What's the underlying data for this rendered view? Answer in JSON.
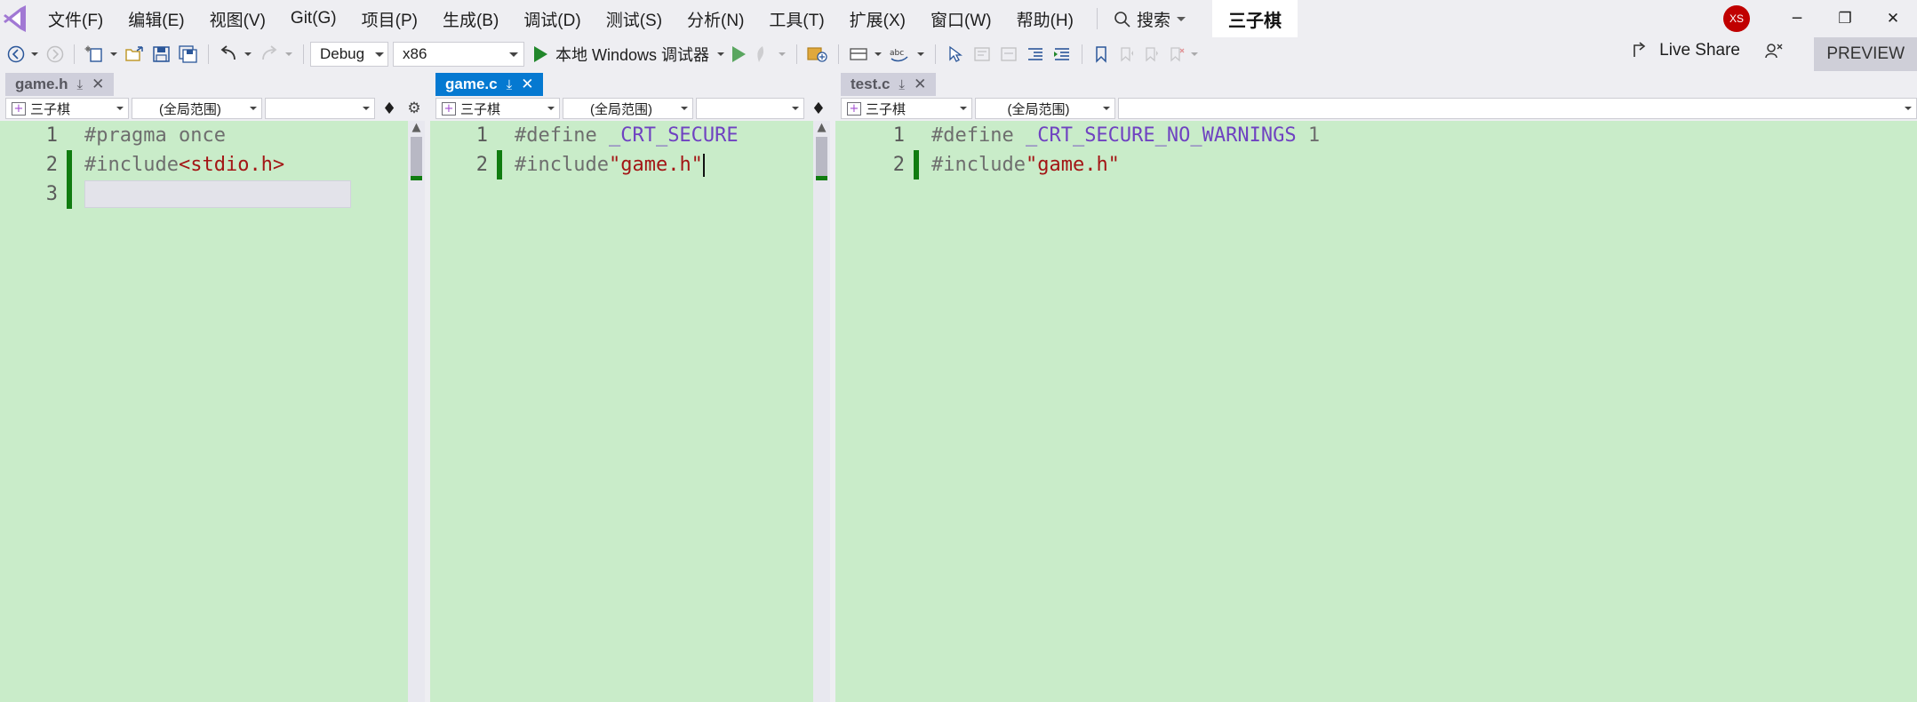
{
  "app": {
    "logo_glyph": "◧",
    "solution_name": "三子棋",
    "avatar_initials": "XS"
  },
  "menubar": {
    "items": [
      {
        "label": "文件(F)"
      },
      {
        "label": "编辑(E)"
      },
      {
        "label": "视图(V)"
      },
      {
        "label": "Git(G)"
      },
      {
        "label": "项目(P)"
      },
      {
        "label": "生成(B)"
      },
      {
        "label": "调试(D)"
      },
      {
        "label": "测试(S)"
      },
      {
        "label": "分析(N)"
      },
      {
        "label": "工具(T)"
      },
      {
        "label": "扩展(X)"
      },
      {
        "label": "窗口(W)"
      },
      {
        "label": "帮助(H)"
      }
    ],
    "search_label": "搜索",
    "window_buttons": {
      "minimize": "─",
      "maximize": "❐",
      "close": "✕"
    }
  },
  "toolbar": {
    "back_icon": "back-arrow",
    "forward_icon": "forward-arrow",
    "new_item_icon": "new-item",
    "open_icon": "open-folder",
    "save_icon": "save",
    "save_all_icon": "save-all",
    "undo_icon": "undo",
    "redo_icon": "redo",
    "configuration": "Debug",
    "platform": "x86",
    "run_label": "本地 Windows 调试器",
    "live_share_label": "Live Share",
    "preview_label": "PREVIEW"
  },
  "panes": [
    {
      "tab": {
        "title": "game.h",
        "active": false,
        "pin": "⤓",
        "close": "✕"
      },
      "navbar": {
        "scope_project": "三子棋",
        "scope_member": "(全局范围)",
        "scope_third": ""
      },
      "lines": [
        {
          "num": "1",
          "changed": false,
          "segments": [
            {
              "text": "#pragma once",
              "cls": "ctext"
            }
          ]
        },
        {
          "num": "2",
          "changed": true,
          "segments": [
            {
              "text": "#include",
              "cls": "ctext"
            },
            {
              "text": "<stdio.h>",
              "cls": "tok-red"
            }
          ]
        },
        {
          "num": "3",
          "changed": true,
          "segments": []
        }
      ]
    },
    {
      "tab": {
        "title": "game.c",
        "active": true,
        "pin": "⤓",
        "close": "✕"
      },
      "navbar": {
        "scope_project": "三子棋",
        "scope_member": "(全局范围)",
        "scope_third": ""
      },
      "lines": [
        {
          "num": "1",
          "changed": false,
          "segments": [
            {
              "text": "#define",
              "cls": "ctext"
            },
            {
              "text": " _CRT_SECURE",
              "cls": "tok-macro"
            }
          ]
        },
        {
          "num": "2",
          "changed": true,
          "segments": [
            {
              "text": "#include",
              "cls": "ctext"
            },
            {
              "text": "\"game.h\"",
              "cls": "tok-str"
            }
          ]
        }
      ]
    },
    {
      "tab": {
        "title": "test.c",
        "active": false,
        "pin": "⤓",
        "close": "✕"
      },
      "navbar": {
        "scope_project": "三子棋",
        "scope_member": "(全局范围)",
        "scope_third": ""
      },
      "lines": [
        {
          "num": "1",
          "changed": false,
          "segments": [
            {
              "text": "#define",
              "cls": "ctext"
            },
            {
              "text": " _CRT_SECURE_NO_WARNINGS",
              "cls": "tok-macro"
            },
            {
              "text": " 1",
              "cls": "ctext"
            }
          ]
        },
        {
          "num": "2",
          "changed": true,
          "segments": [
            {
              "text": "#include",
              "cls": "ctext"
            },
            {
              "text": "\"game.h\"",
              "cls": "tok-str"
            }
          ]
        }
      ]
    }
  ]
}
